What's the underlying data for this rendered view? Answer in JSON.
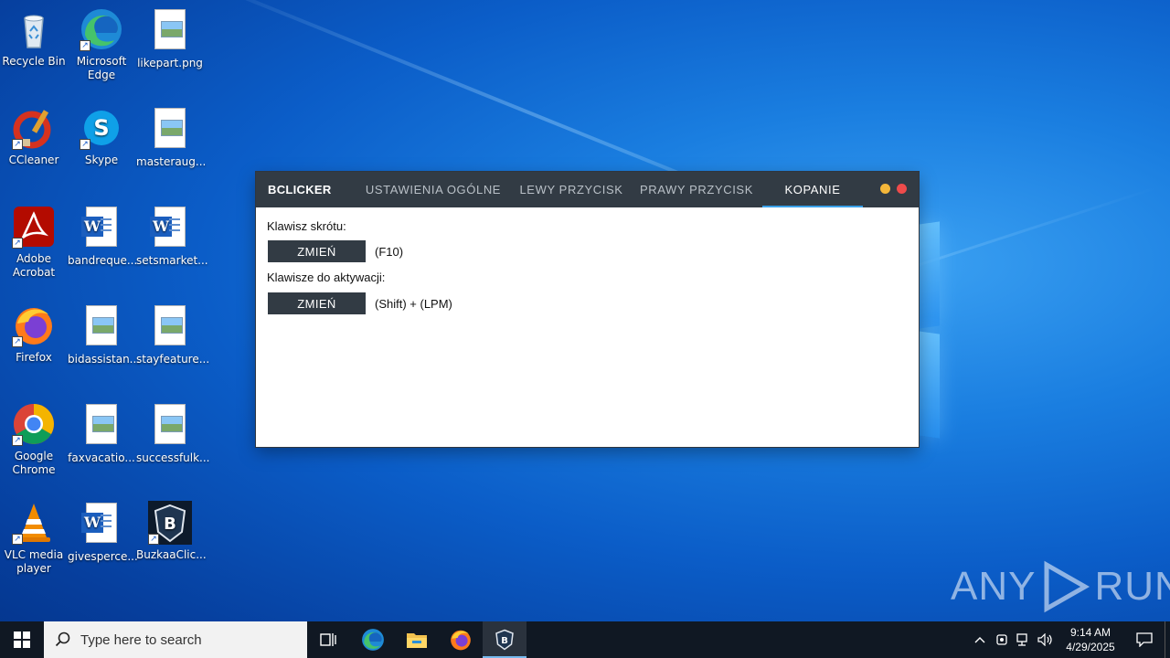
{
  "desktop": {
    "icons": [
      {
        "label": "Recycle Bin",
        "icon": "recycle-bin-icon"
      },
      {
        "label": "Microsoft Edge",
        "icon": "edge-icon"
      },
      {
        "label": "likepart.png",
        "icon": "image-file-icon"
      },
      {
        "label": "CCleaner",
        "icon": "ccleaner-icon"
      },
      {
        "label": "Skype",
        "icon": "skype-icon"
      },
      {
        "label": "masteraug...",
        "icon": "image-file-icon"
      },
      {
        "label": "Adobe Acrobat",
        "icon": "acrobat-icon"
      },
      {
        "label": "bandreque...",
        "icon": "word-file-icon"
      },
      {
        "label": "setsmarket...",
        "icon": "word-file-icon"
      },
      {
        "label": "Firefox",
        "icon": "firefox-icon"
      },
      {
        "label": "bidassistan...",
        "icon": "image-file-icon"
      },
      {
        "label": "stayfeature...",
        "icon": "image-file-icon"
      },
      {
        "label": "Google Chrome",
        "icon": "chrome-icon"
      },
      {
        "label": "faxvacatio...",
        "icon": "image-file-icon"
      },
      {
        "label": "successfulk...",
        "icon": "image-file-icon"
      },
      {
        "label": "VLC media player",
        "icon": "vlc-icon"
      },
      {
        "label": "givesperce...",
        "icon": "word-file-icon"
      },
      {
        "label": "BuzkaaClic...",
        "icon": "buzkaa-clicker-icon"
      }
    ]
  },
  "app": {
    "brand": "BCLICKER",
    "tabs": [
      {
        "label": "USTAWIENIA OGÓLNE",
        "active": false
      },
      {
        "label": "LEWY PRZYCISK",
        "active": false
      },
      {
        "label": "PRAWY PRZYCISK",
        "active": false
      },
      {
        "label": "KOPANIE",
        "active": true
      }
    ],
    "controls": {
      "minimize_color": "#f4b73a",
      "close_color": "#ee4b4b"
    },
    "accent": "#3aa0e8",
    "hotkey": {
      "label": "Klawisz skrótu:",
      "button": "ZMIEŃ",
      "value": "(F10)"
    },
    "activation": {
      "label": "Klawisze do aktywacji:",
      "button": "ZMIEŃ",
      "value": "(Shift) + (LPM)"
    }
  },
  "watermark": {
    "text_left": "ANY",
    "text_right": "RUN"
  },
  "taskbar": {
    "search_placeholder": "Type here to search",
    "pinned": [
      "task-view-icon",
      "edge-icon",
      "file-explorer-icon",
      "firefox-icon",
      "buzkaa-clicker-icon"
    ],
    "active_app": "buzkaa-clicker-icon",
    "clock": {
      "time": "9:14 AM",
      "date": "4/29/2025"
    }
  }
}
